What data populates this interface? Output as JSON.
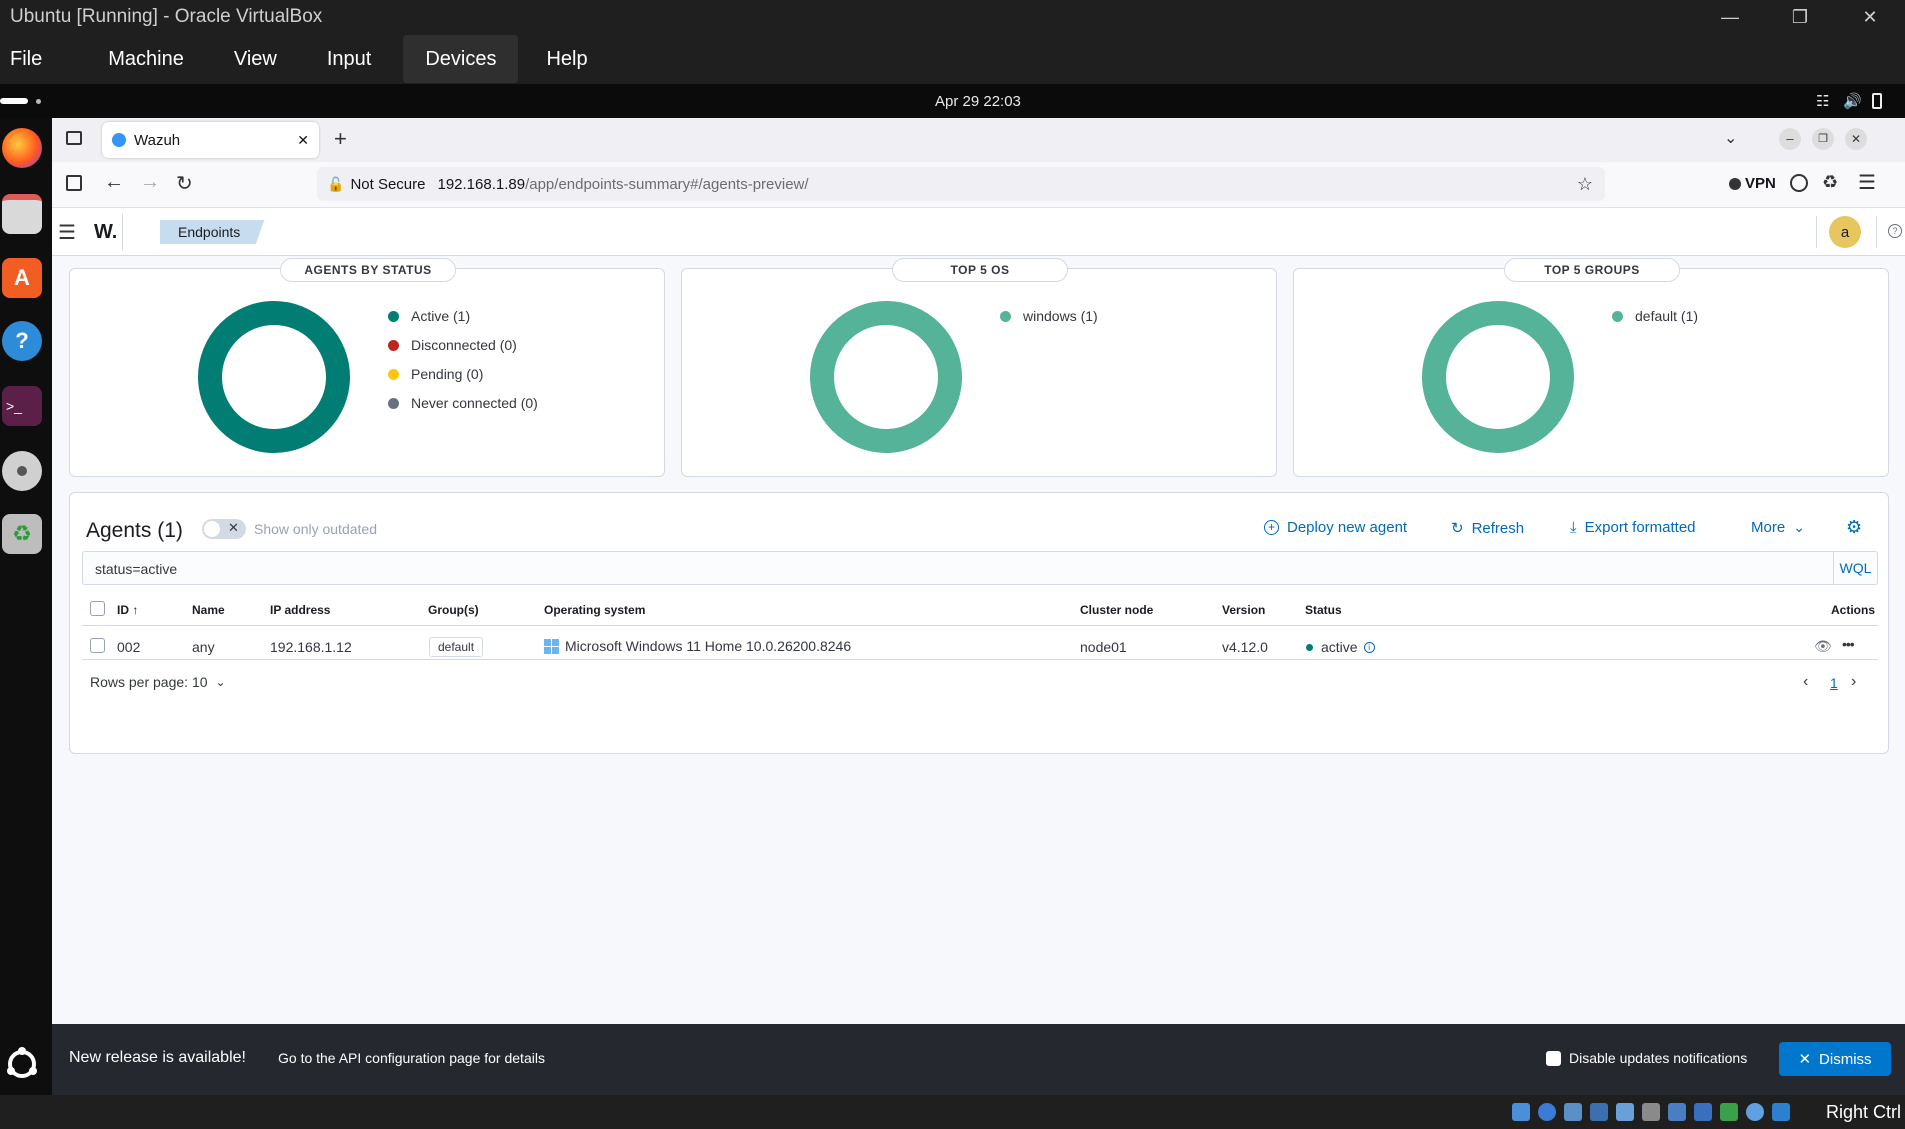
{
  "vbox": {
    "title": "Ubuntu  [Running] - Oracle VirtualBox",
    "menu": [
      "File",
      "Machine",
      "View",
      "Input",
      "Devices",
      "Help"
    ],
    "host_key": "Right Ctrl"
  },
  "ubuntu": {
    "clock": "Apr 29  22:03"
  },
  "browser": {
    "tab_title": "Wazuh",
    "security_label": "Not Secure",
    "url_host": "192.168.1.89",
    "url_path": "/app/endpoints-summary#/agents-preview/",
    "vpn_label": "VPN"
  },
  "app": {
    "logo": "W.",
    "breadcrumb": "Endpoints",
    "user_initial": "a"
  },
  "panels": {
    "status": {
      "title": "AGENTS BY STATUS",
      "legend": [
        {
          "label": "Active (1)",
          "color": "#017d73"
        },
        {
          "label": "Disconnected (0)",
          "color": "#bd271e"
        },
        {
          "label": "Pending (0)",
          "color": "#fec514"
        },
        {
          "label": "Never connected (0)",
          "color": "#69707d"
        }
      ]
    },
    "os": {
      "title": "TOP 5 OS",
      "legend": [
        {
          "label": "windows (1)",
          "color": "#54b399"
        }
      ]
    },
    "groups": {
      "title": "TOP 5 GROUPS",
      "legend": [
        {
          "label": "default (1)",
          "color": "#54b399"
        }
      ]
    }
  },
  "agents": {
    "title": "Agents (1)",
    "toggle_label": "Show only outdated",
    "actions": {
      "deploy": "Deploy new agent",
      "refresh": "Refresh",
      "export": "Export formatted",
      "more": "More"
    },
    "search_value": "status=active",
    "search_lang": "WQL",
    "columns": [
      "ID",
      "Name",
      "IP address",
      "Group(s)",
      "Operating system",
      "Cluster node",
      "Version",
      "Status",
      "Actions"
    ],
    "rows": [
      {
        "id": "002",
        "name": "any",
        "ip": "192.168.1.12",
        "group": "default",
        "os": "Microsoft Windows 11 Home 10.0.26200.8246",
        "cluster_node": "node01",
        "version": "v4.12.0",
        "status": "active"
      }
    ],
    "rows_per_page": "Rows per page: 10",
    "page": "1"
  },
  "notification": {
    "title": "New release is available!",
    "message": "Go to the API configuration page for details",
    "checkbox_label": "Disable updates notifications",
    "dismiss_label": "Dismiss"
  }
}
